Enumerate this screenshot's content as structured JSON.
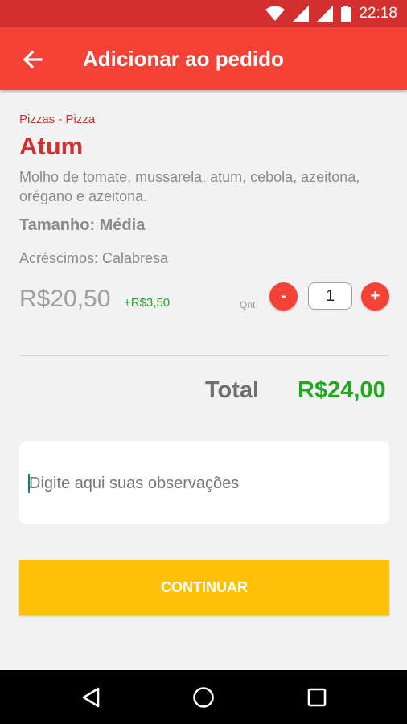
{
  "status_bar": {
    "time": "22:18",
    "icons": [
      "wifi-icon",
      "signal-icon",
      "signal-icon",
      "battery-icon"
    ]
  },
  "app_bar": {
    "back_icon": "arrow-left-icon",
    "title": "Adicionar ao pedido"
  },
  "product": {
    "breadcrumb": "Pizzas - Pizza",
    "name": "Atum",
    "description": "Molho de tomate, mussarela, atum, cebola, azeitona, orégano e azeitona.",
    "size_label": "Tamanho:",
    "size_value": "Média",
    "extras": "Acréscimos: Calabresa",
    "price": "R$20,50",
    "extra_price": "+R$3,50"
  },
  "quantity": {
    "label": "Qnt.",
    "minus": "-",
    "value": "1",
    "plus": "+"
  },
  "total": {
    "label": "Total",
    "value": "R$24,00"
  },
  "notes": {
    "placeholder": "Digite aqui suas observações"
  },
  "continue_button": "CONTINUAR",
  "nav_bar": {
    "icons": [
      "back-triangle-icon",
      "home-circle-icon",
      "recents-square-icon"
    ]
  },
  "colors": {
    "primary": "#f44336",
    "status_bar": "#d32f2f",
    "accent_green": "#21a821",
    "button_yellow": "#ffc107"
  }
}
